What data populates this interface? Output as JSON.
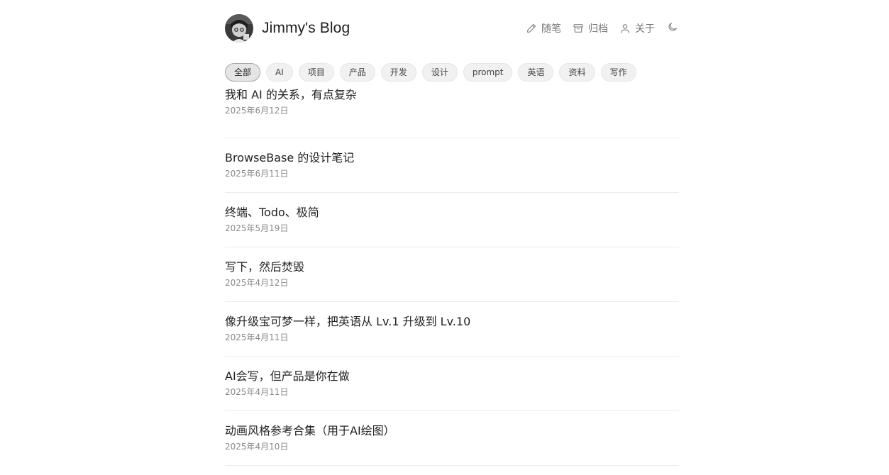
{
  "header": {
    "site_title": "Jimmy's Blog",
    "avatar_icon": "avatar-portrait",
    "nav": [
      {
        "label": "随笔",
        "icon": "pencil-icon"
      },
      {
        "label": "归档",
        "icon": "archive-box-icon"
      },
      {
        "label": "关于",
        "icon": "user-icon"
      }
    ],
    "theme_toggle_icon": "moon-icon"
  },
  "tags": [
    {
      "label": "全部",
      "active": true
    },
    {
      "label": "AI",
      "active": false
    },
    {
      "label": "项目",
      "active": false
    },
    {
      "label": "产品",
      "active": false
    },
    {
      "label": "开发",
      "active": false
    },
    {
      "label": "设计",
      "active": false
    },
    {
      "label": "prompt",
      "active": false
    },
    {
      "label": "英语",
      "active": false
    },
    {
      "label": "资料",
      "active": false
    },
    {
      "label": "写作",
      "active": false
    }
  ],
  "posts": [
    {
      "title": "我和 AI 的关系，有点复杂",
      "date": "2025年6月12日"
    },
    {
      "title": "BrowseBase 的设计笔记",
      "date": "2025年6月11日"
    },
    {
      "title": "终端、Todo、极简",
      "date": "2025年5月19日"
    },
    {
      "title": "写下，然后焚毁",
      "date": "2025年4月12日"
    },
    {
      "title": "像升级宝可梦一样，把英语从 Lv.1 升级到 Lv.10",
      "date": "2025年4月11日"
    },
    {
      "title": "AI会写，但产品是你在做",
      "date": "2025年4月11日"
    },
    {
      "title": "动画风格参考合集（用于AI绘图）",
      "date": "2025年4月10日"
    }
  ],
  "colors": {
    "text": "#222222",
    "muted": "#777777",
    "date": "#8a8a8a",
    "divider": "#ececec",
    "tag_bg": "#f1f1f1",
    "tag_active_border": "#a6a6a6"
  }
}
